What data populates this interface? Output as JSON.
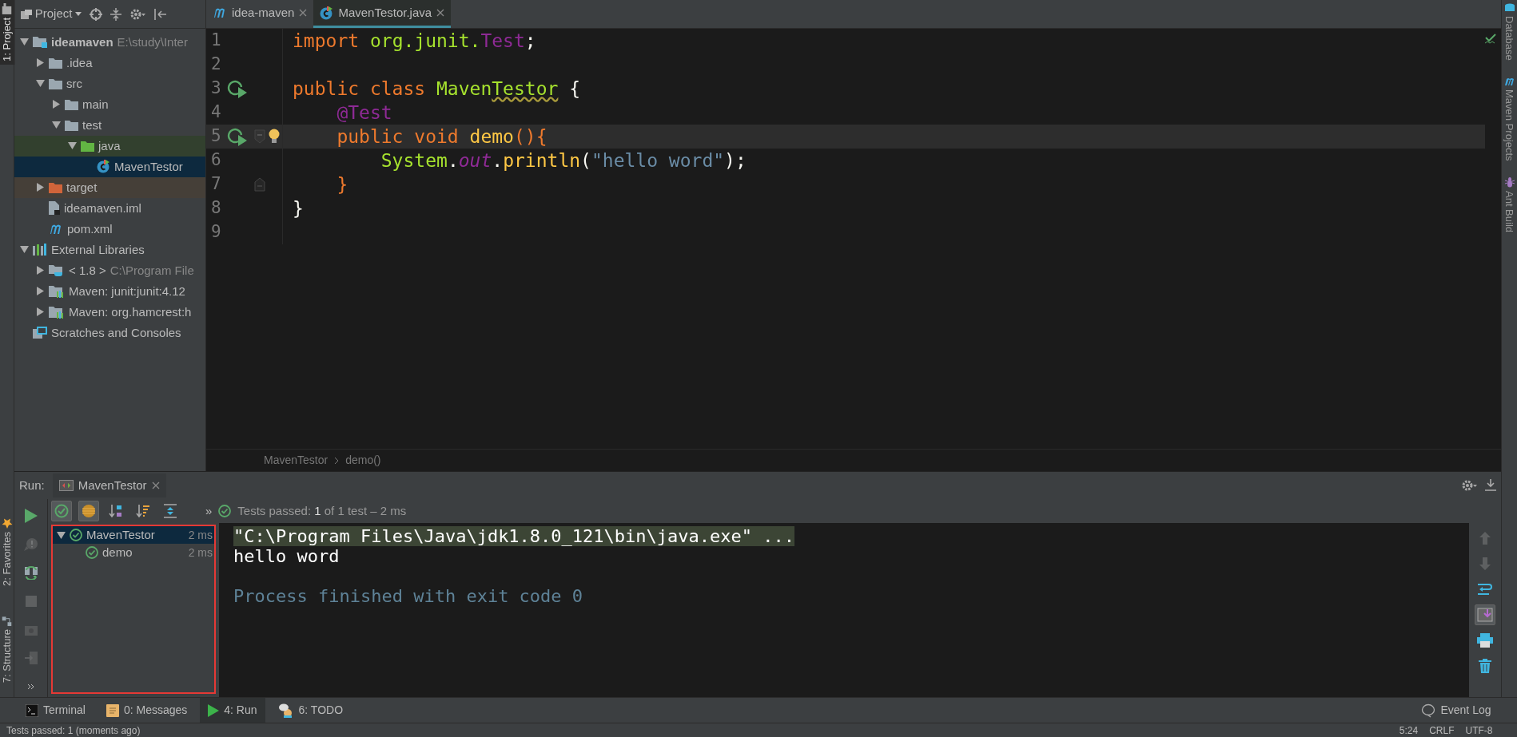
{
  "left_strip": [
    {
      "label": "1: Project",
      "kind": "project",
      "selected": true
    },
    {
      "label": "2: Favorites",
      "kind": "favorites",
      "selected": false
    },
    {
      "label": "7: Structure",
      "kind": "structure",
      "selected": false
    }
  ],
  "project_panel": {
    "title": "Project",
    "tree": [
      {
        "label": "ideamaven",
        "hint": "E:\\study\\Inter",
        "kind": "module",
        "expanded": true,
        "selected": false,
        "children": [
          {
            "label": ".idea",
            "kind": "folder",
            "expanded": false,
            "selected": false
          },
          {
            "label": "src",
            "kind": "folder",
            "expanded": true,
            "selected": false,
            "children": [
              {
                "label": "main",
                "kind": "folder",
                "expanded": false,
                "selected": false
              },
              {
                "label": "test",
                "kind": "folder",
                "expanded": true,
                "selected": false,
                "children": [
                  {
                    "label": "java",
                    "kind": "test-root",
                    "expanded": true,
                    "selected": false,
                    "children": [
                      {
                        "label": "MavenTestor",
                        "kind": "class",
                        "selected": true
                      }
                    ]
                  }
                ]
              }
            ]
          },
          {
            "label": "target",
            "kind": "excluded",
            "expanded": false,
            "selected": false
          },
          {
            "label": "ideamaven.iml",
            "kind": "file",
            "selected": false
          },
          {
            "label": "pom.xml",
            "kind": "maven",
            "selected": false
          }
        ]
      },
      {
        "label": "External Libraries",
        "kind": "libraries",
        "expanded": true,
        "selected": false,
        "children": [
          {
            "label": "< 1.8 >",
            "hint": "C:\\Program File",
            "kind": "jdk",
            "expanded": false,
            "selected": false
          },
          {
            "label": "Maven: junit:junit:4.12",
            "kind": "library",
            "expanded": false,
            "selected": false
          },
          {
            "label": "Maven: org.hamcrest:h",
            "kind": "library",
            "expanded": false,
            "selected": false
          }
        ]
      },
      {
        "label": "Scratches and Consoles",
        "kind": "scratches",
        "selected": false
      }
    ]
  },
  "editor": {
    "tabs": [
      {
        "label": "idea-maven",
        "kind": "maven",
        "selected": false
      },
      {
        "label": "MavenTestor.java",
        "kind": "class",
        "selected": true
      }
    ],
    "lines": [
      {
        "number": "1",
        "tokens": [
          {
            "text": "import ",
            "kind": "keyword"
          },
          {
            "text": "org.junit.",
            "kind": "ident"
          },
          {
            "text": "Test",
            "kind": "type"
          },
          {
            "text": ";",
            "kind": "plain"
          }
        ]
      },
      {
        "number": "2"
      },
      {
        "number": "3",
        "runnable": true,
        "tokens": [
          {
            "text": "public class ",
            "kind": "keyword"
          },
          {
            "text": "Maven",
            "kind": "ident"
          },
          {
            "text": "Testor",
            "kind": "warning"
          },
          {
            "text": " {",
            "kind": "plain"
          }
        ]
      },
      {
        "number": "4",
        "tokens": [
          {
            "text": "    @Test",
            "kind": "type"
          }
        ]
      },
      {
        "number": "5",
        "runnable": true,
        "fold_start": true,
        "bulb": true,
        "current": true,
        "tokens": [
          {
            "text": "    public void ",
            "kind": "keyword"
          },
          {
            "text": "demo",
            "kind": "method"
          },
          {
            "text": "(){",
            "kind": "keyword"
          }
        ]
      },
      {
        "number": "6",
        "tokens": [
          {
            "text": "        System",
            "kind": "ident"
          },
          {
            "text": ".",
            "kind": "plain"
          },
          {
            "text": "out",
            "kind": "field"
          },
          {
            "text": ".",
            "kind": "plain"
          },
          {
            "text": "println",
            "kind": "method"
          },
          {
            "text": "(",
            "kind": "plain"
          },
          {
            "text": "\"hello word\"",
            "kind": "string"
          },
          {
            "text": ");",
            "kind": "plain"
          }
        ]
      },
      {
        "number": "7",
        "fold_end": true,
        "tokens": [
          {
            "text": "    }",
            "kind": "keyword"
          }
        ]
      },
      {
        "number": "8",
        "tokens": [
          {
            "text": "}",
            "kind": "plain"
          }
        ]
      },
      {
        "number": "9"
      }
    ],
    "breadcrumbs": [
      "MavenTestor",
      "demo()"
    ]
  },
  "right_strip": [
    {
      "label": "Database",
      "kind": "database"
    },
    {
      "label": "Maven Projects",
      "kind": "maven"
    },
    {
      "label": "Ant Build",
      "kind": "ant"
    }
  ],
  "run_panel": {
    "title": "Run:",
    "tab": "MavenTestor",
    "side_tools": [
      {
        "kind": "rerun",
        "disabled": false
      },
      {
        "kind": "rerun-failed",
        "disabled": true
      },
      {
        "kind": "toggle-auto",
        "disabled": false
      },
      {
        "kind": "stop",
        "disabled": true
      },
      {
        "kind": "dump",
        "disabled": true
      },
      {
        "kind": "exit",
        "disabled": true
      },
      {
        "kind": "more",
        "disabled": false
      }
    ],
    "test_tools": [
      {
        "kind": "show-passed",
        "on": true
      },
      {
        "kind": "show-ignored",
        "on": true
      },
      {
        "kind": "sort-alpha",
        "on": false
      },
      {
        "kind": "sort-duration",
        "on": false
      },
      {
        "kind": "expand",
        "on": false
      }
    ],
    "overflow": "»",
    "status": {
      "label": "Tests passed:",
      "count": "1",
      "rest": "of 1 test – 2 ms"
    },
    "annotated": true,
    "tests": [
      {
        "name": "MavenTestor",
        "time": "2 ms",
        "passed": true,
        "expanded": true,
        "selected": true,
        "children": [
          {
            "name": "demo",
            "time": "2 ms",
            "passed": true,
            "selected": false
          }
        ]
      }
    ],
    "console": [
      {
        "kind": "command",
        "text": "\"C:\\Program Files\\Java\\jdk1.8.0_121\\bin\\java.exe\" ..."
      },
      {
        "kind": "output",
        "text": "hello word"
      },
      {
        "kind": "blank"
      },
      {
        "kind": "system",
        "text": "Process finished with exit code 0"
      }
    ],
    "console_tools": [
      {
        "kind": "up",
        "on": false,
        "disabled": true
      },
      {
        "kind": "down",
        "on": false,
        "disabled": true
      },
      {
        "kind": "wrap",
        "on": false,
        "disabled": false
      },
      {
        "kind": "scroll-end",
        "on": true,
        "disabled": false
      },
      {
        "kind": "print",
        "on": false,
        "disabled": false
      },
      {
        "kind": "trash",
        "on": false,
        "disabled": false
      }
    ]
  },
  "tool_tabs": [
    {
      "label": "Terminal",
      "kind": "terminal",
      "selected": false
    },
    {
      "label": "0: Messages",
      "kind": "messages",
      "selected": false
    },
    {
      "label": "4: Run",
      "kind": "run",
      "selected": true
    },
    {
      "label": "6: TODO",
      "kind": "todo",
      "selected": false
    }
  ],
  "event_log": "Event Log",
  "status_bar": {
    "message": "Tests passed: 1 (moments ago)",
    "position": "5:24",
    "line_sep": "CRLF",
    "encoding": "UTF-8"
  }
}
